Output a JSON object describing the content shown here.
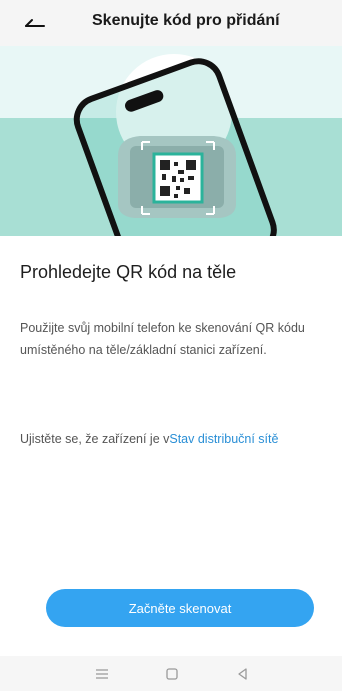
{
  "header": {
    "back_icon": "back-arrow-icon",
    "title": "Skenujte kód pro přidání"
  },
  "hero": {
    "illustration": "phone-scanning-qr-device",
    "colors": {
      "background": "#e8f7f6",
      "floor": "#a8dfd4",
      "frame": "#3cc0a8"
    }
  },
  "content": {
    "heading": "Prohledejte QR kód na těle",
    "description": "Použijte svůj mobilní telefon ke skenování QR kódu umístěného na těle/základní stanici zařízení.",
    "note_prefix": "Ujistěte se, že zařízení je v",
    "note_link": "Stav distribuční sítě"
  },
  "actions": {
    "scan_button": "Začněte skenovat",
    "accent_color": "#34a4f1"
  },
  "system_nav": {
    "items": [
      "menu-icon",
      "home-icon",
      "back-icon"
    ]
  }
}
